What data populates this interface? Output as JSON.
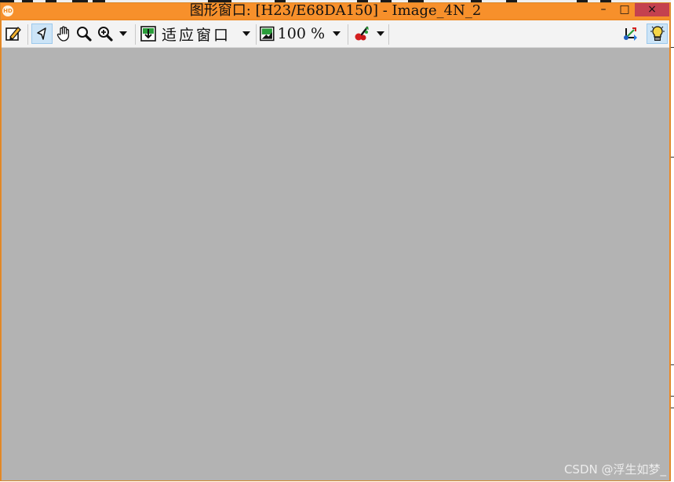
{
  "window": {
    "title": "图形窗口: [H23/E68DA150] - Image_4N_2",
    "logo_text": "HD",
    "minimize_glyph": "–",
    "maximize_glyph": "□",
    "close_glyph": "×"
  },
  "toolbar": {
    "fit_label": "适应窗口",
    "zoom_label": "100 %"
  },
  "watermark": "CSDN @浮生如梦_",
  "colors": {
    "title_bar": "#f7902b",
    "canvas": "#b3b3b3",
    "selected_tool": "#cce4f7",
    "close_button": "#c4414f"
  }
}
